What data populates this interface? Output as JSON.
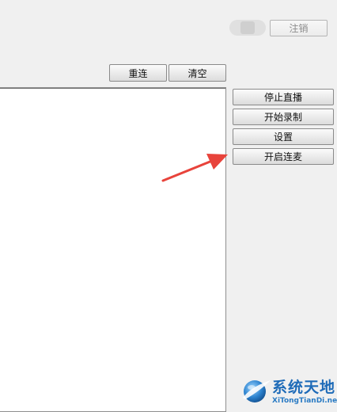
{
  "header": {
    "logout_label": "注销"
  },
  "toolbar": {
    "reconnect_label": "重连",
    "clear_label": "清空"
  },
  "side_panel": {
    "buttons": [
      {
        "label": "停止直播"
      },
      {
        "label": "开始录制"
      },
      {
        "label": "设置"
      },
      {
        "label": "开启连麦"
      }
    ]
  },
  "annotation": {
    "arrow_color": "#e8433b",
    "target": "开启连麦"
  },
  "watermark": {
    "name": "系统天地",
    "site": "XiTongTianDi.net",
    "color": "#1e6bb8"
  }
}
